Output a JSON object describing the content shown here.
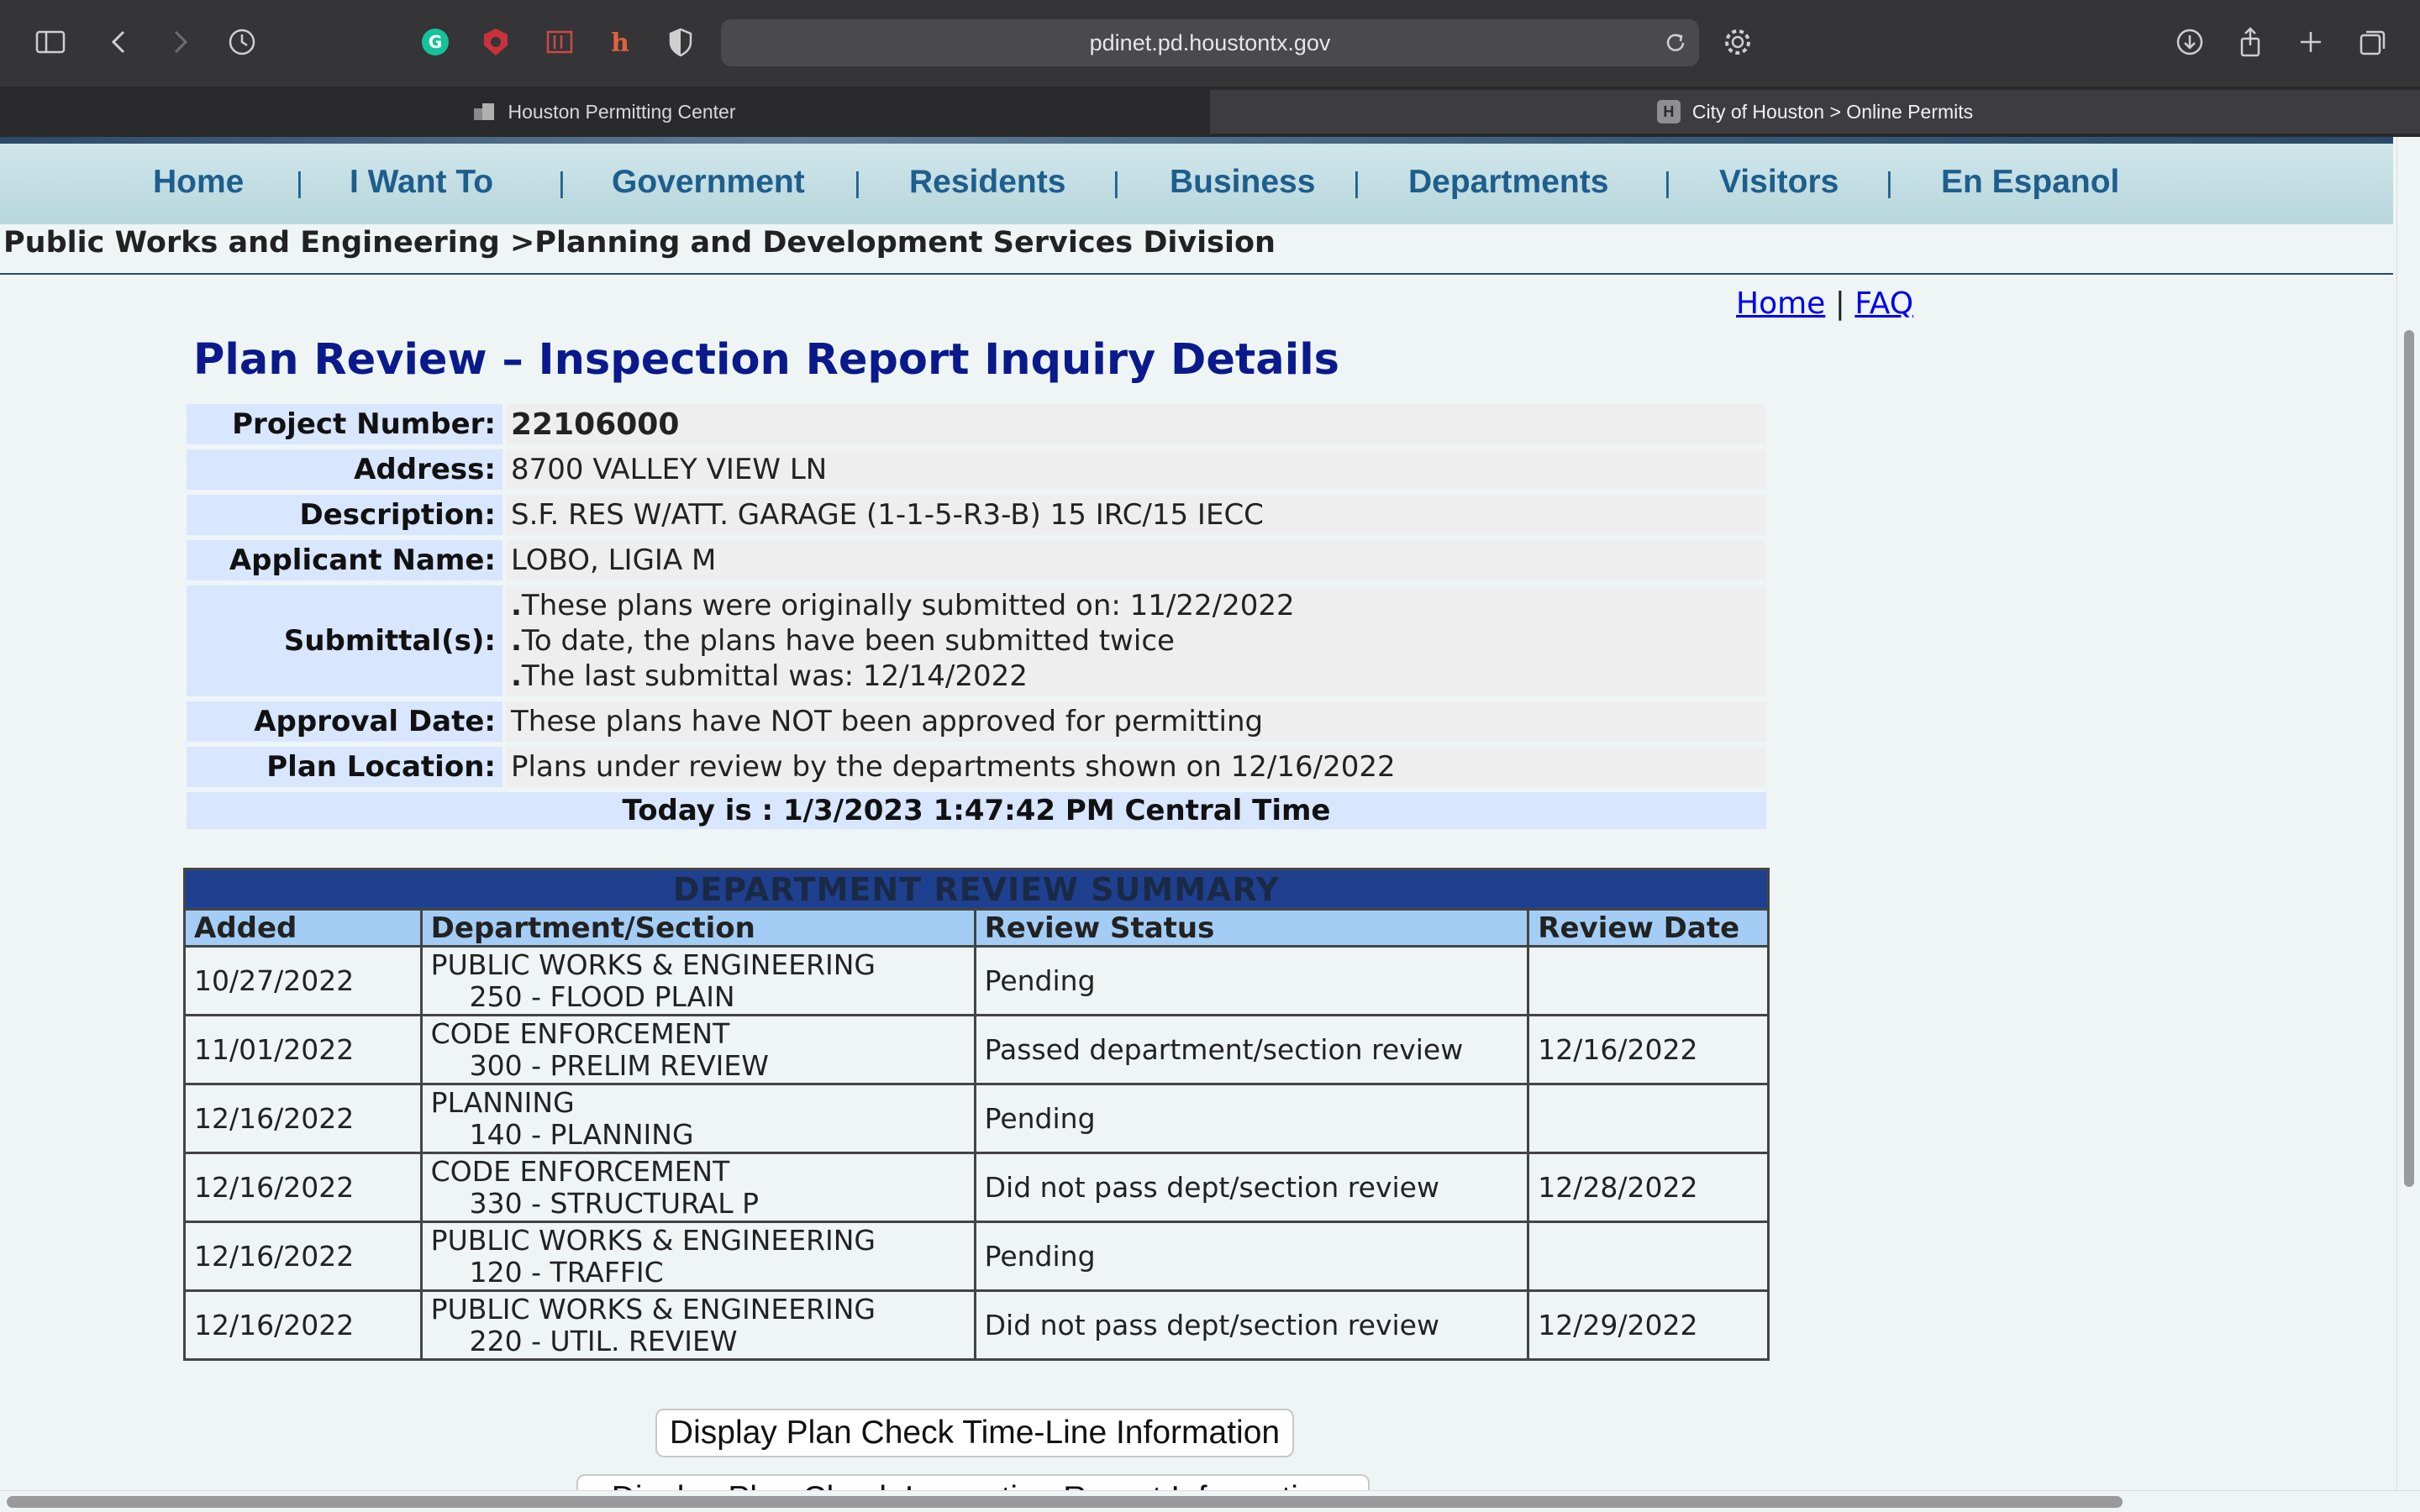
{
  "browser": {
    "url": "pdinet.pd.houstontx.gov",
    "tabs": [
      {
        "title": "Houston Permitting Center"
      },
      {
        "title": "City of Houston > Online Permits",
        "favicon_letter": "H"
      }
    ],
    "close_glyph": "×"
  },
  "nav": {
    "items": [
      "Home",
      "I Want To",
      "Government",
      "Residents",
      "Business",
      "Departments",
      "Visitors",
      "En Espanol"
    ],
    "separator": "|"
  },
  "breadcrumb": "Public Works and Engineering >Planning and Development Services Division",
  "links": {
    "home": "Home",
    "separator": "|",
    "faq": "FAQ"
  },
  "title": "Plan Review – Inspection Report Inquiry Details",
  "info": {
    "project_number_label": "Project Number:",
    "project_number": "22106000",
    "address_label": "Address:",
    "address": "8700 VALLEY VIEW LN",
    "description_label": "Description:",
    "description": "S.F. RES W/ATT. GARAGE (1-1-5-R3-B) 15 IRC/15 IECC",
    "applicant_label": "Applicant Name:",
    "applicant": "LOBO, LIGIA M",
    "submittals_label": "Submittal(s):",
    "submittals": [
      "These plans were originally submitted on: 11/22/2022",
      "To date, the plans have been submitted twice",
      "The last submittal was: 12/14/2022"
    ],
    "approval_label": "Approval Date:",
    "approval": "These plans have NOT been approved for permitting",
    "location_label": "Plan Location:",
    "location": "Plans under review by the departments shown on 12/16/2022",
    "today": "Today is : 1/3/2023 1:47:42 PM Central Time"
  },
  "summary": {
    "caption": "DEPARTMENT REVIEW SUMMARY",
    "headers": [
      "Added",
      "Department/Section",
      "Review Status",
      "Review Date"
    ],
    "rows": [
      {
        "added": "10/27/2022",
        "dept": "PUBLIC WORKS & ENGINEERING",
        "section": "250 - FLOOD PLAIN",
        "status": "Pending",
        "date": ""
      },
      {
        "added": "11/01/2022",
        "dept": "CODE ENFORCEMENT",
        "section": "300 - PRELIM REVIEW",
        "status": "Passed department/section review",
        "date": "12/16/2022"
      },
      {
        "added": "12/16/2022",
        "dept": "PLANNING",
        "section": "140 - PLANNING",
        "status": "Pending",
        "date": ""
      },
      {
        "added": "12/16/2022",
        "dept": "CODE ENFORCEMENT",
        "section": "330 - STRUCTURAL P",
        "status": "Did not pass dept/section review",
        "date": "12/28/2022"
      },
      {
        "added": "12/16/2022",
        "dept": "PUBLIC WORKS & ENGINEERING",
        "section": "120 - TRAFFIC",
        "status": "Pending",
        "date": ""
      },
      {
        "added": "12/16/2022",
        "dept": "PUBLIC WORKS & ENGINEERING",
        "section": "220 - UTIL. REVIEW",
        "status": "Did not pass dept/section review",
        "date": "12/29/2022"
      }
    ]
  },
  "buttons": {
    "timeline": "Display Plan Check Time-Line Information",
    "inspection": "Display Plan Check Inspection Report Information"
  },
  "colors": {
    "title": "#0a1a8c",
    "nav_text": "#1e5e8d",
    "label_bg": "#d8e6ff",
    "table_caption_bg": "#1f3f8f",
    "table_header_bg": "#a3cdf5"
  }
}
